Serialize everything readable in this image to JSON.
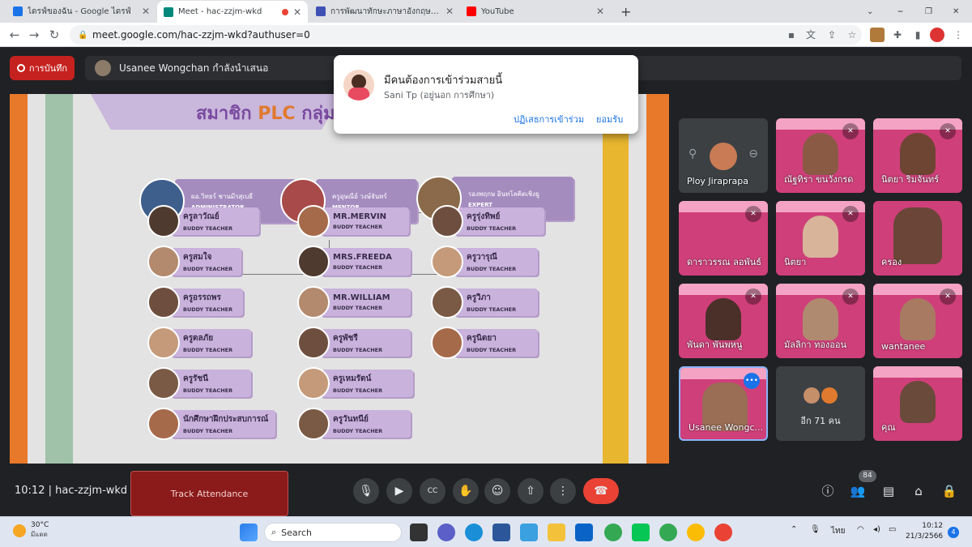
{
  "browser": {
    "tabs": [
      {
        "title": "ไดรฟ์ของฉัน - Google ไดรฟ์",
        "favicon": "google-drive-icon",
        "color": "#1a73e8"
      },
      {
        "title": "Meet - hac-zzjm-wkd",
        "favicon": "google-meet-icon",
        "color": "#00897b",
        "active": true
      },
      {
        "title": "การพัฒนาทักษะภาษาอังกฤษ English",
        "favicon": "google-classroom-icon",
        "color": "#3f51b5"
      },
      {
        "title": "YouTube",
        "favicon": "youtube-icon",
        "color": "#ff0000"
      }
    ],
    "address": "meet.google.com/hac-zzjm-wkd?authuser=0"
  },
  "meet": {
    "record_label": "การบันทึก",
    "presenter_text": "Usanee Wongchan กำลังนำเสนอ",
    "meeting_code": "10:12  |  hac-zzjm-wkd",
    "track_attendance": "Track Attendance",
    "participant_count": "84",
    "more_people": "อีก 71 คน"
  },
  "notification": {
    "heading": "มีคนต้องการเข้าร่วมสายนี้",
    "person": "Sani Tp (อยู่นอก การศึกษา)",
    "deny": "ปฏิเสธการเข้าร่วม",
    "accept": "ยอมรับ"
  },
  "slide": {
    "title_prefix": "สมาชิก",
    "title_plc": "PLC",
    "title_suffix": "กลุ่ม",
    "top": [
      {
        "name": "ผอ.วิทธร์ ชานมีรสุเบธี",
        "role": "ADMINISTRATOR"
      },
      {
        "name": "ครูอุษณีย์ วงษ์จันทร์",
        "role": "MENTOR"
      },
      {
        "name": "รองพฤกษ อินทโลคิตเชิงยู",
        "role": "EXPERT"
      }
    ],
    "col1": [
      {
        "name": "ครูลาวัณย์",
        "role": "BUDDY TEACHER"
      },
      {
        "name": "ครูสมใจ",
        "role": "BUDDY TEACHER"
      },
      {
        "name": "ครูอรรถพร",
        "role": "BUDDY TEACHER"
      },
      {
        "name": "ครูตลภัย",
        "role": "BUDDY TEACHER"
      },
      {
        "name": "ครูรัชนี",
        "role": "BUDDY TEACHER"
      },
      {
        "name": "นักศึกษาฝึกประสบการณ์",
        "role": "BUDDY TEACHER"
      }
    ],
    "col2": [
      {
        "name": "MR.MERVIN",
        "role": "BUDDY TEACHER"
      },
      {
        "name": "MRS.FREEDA",
        "role": "BUDDY TEACHER"
      },
      {
        "name": "MR.WILLIAM",
        "role": "BUDDY TEACHER"
      },
      {
        "name": "ครูพัชรี",
        "role": "BUDDY TEACHER"
      },
      {
        "name": "ครูเหมรัตน์",
        "role": "BUDDY TEACHER"
      },
      {
        "name": "ครูวันทนีย์",
        "role": "BUDDY TEACHER"
      }
    ],
    "col3": [
      {
        "name": "ครูรุ่งทิพย์",
        "role": "BUDDY TEACHER"
      },
      {
        "name": "ครูวารุณี",
        "role": "BUDDY TEACHER"
      },
      {
        "name": "ครูวิภา",
        "role": "BUDDY TEACHER"
      },
      {
        "name": "ครูนิตยา",
        "role": "BUDDY TEACHER"
      }
    ]
  },
  "participants": [
    {
      "name": "Ploy Jiraprapa"
    },
    {
      "name": "ณัฐทิรา ขนวังกรด"
    },
    {
      "name": "นิตยา ริมจันทร์"
    },
    {
      "name": "ดาราวรรณ ลอพันธ์"
    },
    {
      "name": "นิตยา"
    },
    {
      "name": "ครอง"
    },
    {
      "name": "พันดา พันพหนู"
    },
    {
      "name": "มัลลิกา ทองออน"
    },
    {
      "name": "wantanee"
    },
    {
      "name": "Usanee Wongc..."
    },
    {
      "name": "คุณ"
    }
  ],
  "taskbar": {
    "temp": "30°C",
    "weather": "มีแดด",
    "search": "Search",
    "lang": "ไทย",
    "time": "10:12",
    "date": "21/3/2566",
    "notif_count": "4"
  }
}
